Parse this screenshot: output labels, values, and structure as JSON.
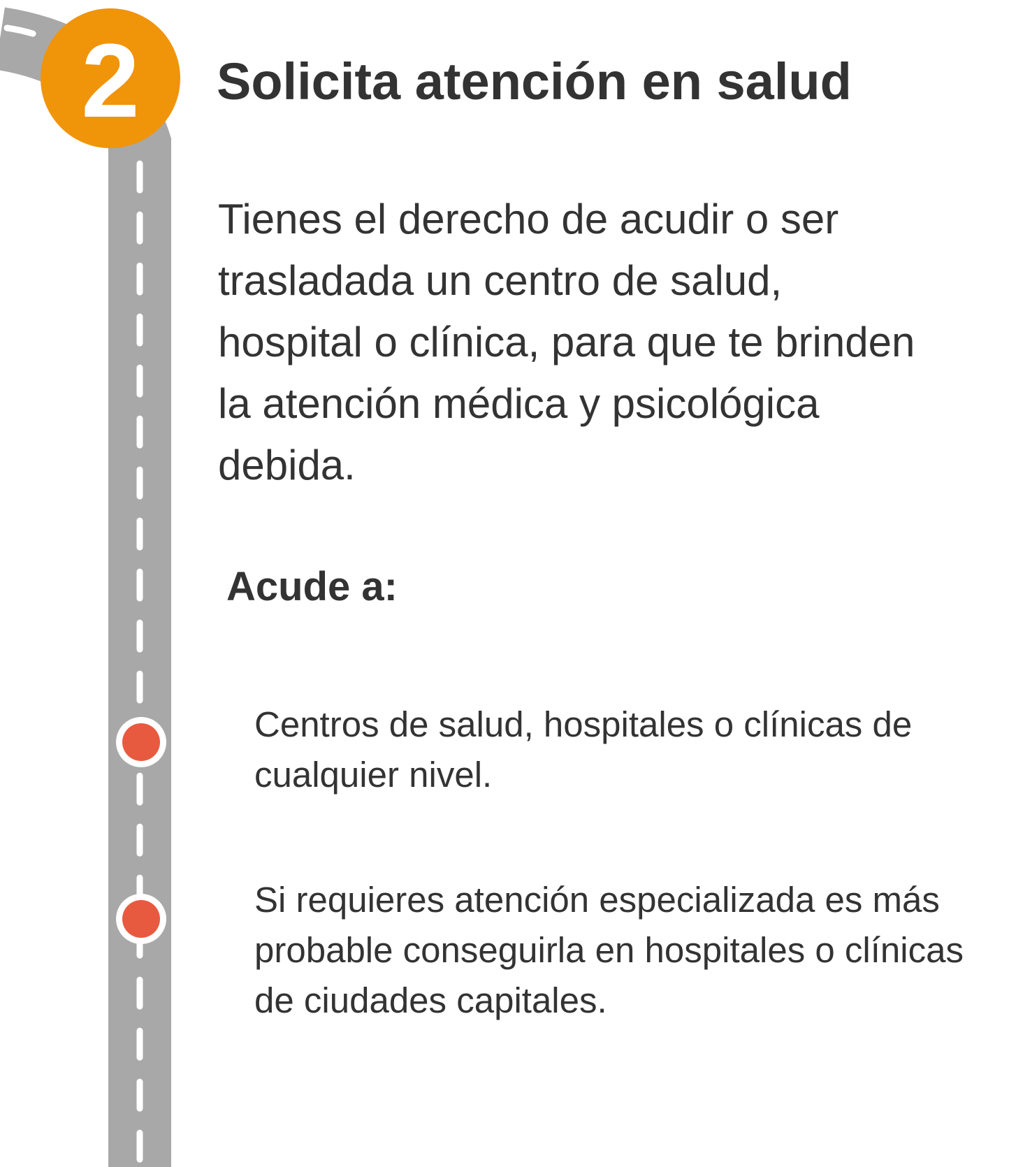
{
  "step": {
    "number": "2",
    "title": "Solicita atención en salud"
  },
  "intro_text": "Tienes el derecho de acudir o ser trasladada un centro de salud, hospital o clínica, para que te brinden la atención médica y psicológica debida.",
  "subheading": "Acude a:",
  "options": [
    {
      "text": "Centros de salud, hospitales o clínicas de cualquier nivel."
    },
    {
      "text": "Si requieres atención especializada es más probable conseguirla en hospitales o clínicas de ciudades capitales."
    }
  ],
  "colors": {
    "badge": "#f0940a",
    "road": "#a8a8a8",
    "lane_marks": "#ffffff",
    "milestone_dot": "#e85a3f",
    "text": "#333333"
  }
}
